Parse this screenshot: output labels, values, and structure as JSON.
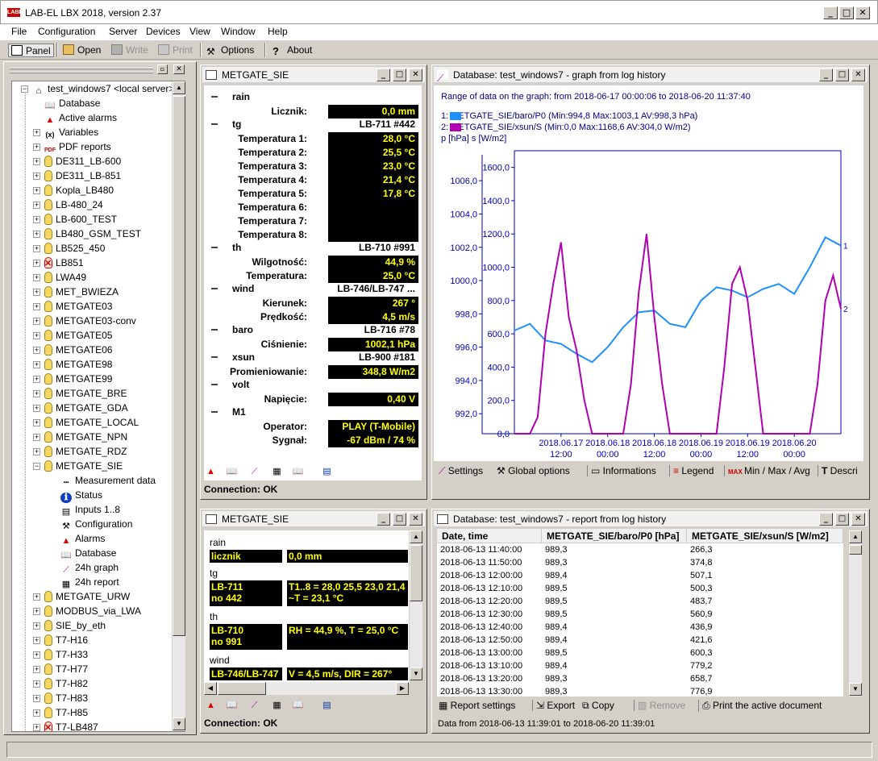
{
  "app": {
    "title": "LAB-EL LBX 2018, version 2.37",
    "logo": "LABEL"
  },
  "menu": [
    "File",
    "Configuration",
    "Server",
    "Devices",
    "View",
    "Window",
    "Help"
  ],
  "toolbar": {
    "panel": "Panel",
    "open": "Open",
    "write": "Write",
    "print": "Print",
    "options": "Options",
    "about": "About"
  },
  "tree": {
    "root": "test_windows7 <local server>",
    "items": [
      {
        "label": "Database",
        "icon": "book-icon",
        "exp": false
      },
      {
        "label": "Active alarms",
        "icon": "alarm-icon",
        "exp": false
      },
      {
        "label": "Variables",
        "icon": "variables-icon",
        "exp": true
      },
      {
        "label": "PDF reports",
        "icon": "pdf-icon",
        "exp": true
      },
      {
        "label": "DE311_LB-600",
        "icon": "bulb",
        "exp": true
      },
      {
        "label": "DE311_LB-851",
        "icon": "bulb",
        "exp": true
      },
      {
        "label": "Kopla_LB480",
        "icon": "bulb",
        "exp": true
      },
      {
        "label": "LB-480_24",
        "icon": "bulb",
        "exp": true
      },
      {
        "label": "LB-600_TEST",
        "icon": "bulb",
        "exp": true
      },
      {
        "label": "LB480_GSM_TEST",
        "icon": "bulb",
        "exp": true
      },
      {
        "label": "LB525_450",
        "icon": "bulb",
        "exp": true
      },
      {
        "label": "LB851",
        "icon": "bulb-red",
        "exp": true
      },
      {
        "label": "LWA49",
        "icon": "bulb",
        "exp": true
      },
      {
        "label": "MET_BWIEZA",
        "icon": "bulb",
        "exp": true
      },
      {
        "label": "METGATE03",
        "icon": "bulb",
        "exp": true
      },
      {
        "label": "METGATE03-conv",
        "icon": "bulb",
        "exp": true
      },
      {
        "label": "METGATE05",
        "icon": "bulb",
        "exp": true
      },
      {
        "label": "METGATE06",
        "icon": "bulb",
        "exp": true
      },
      {
        "label": "METGATE98",
        "icon": "bulb",
        "exp": true
      },
      {
        "label": "METGATE99",
        "icon": "bulb",
        "exp": true
      },
      {
        "label": "METGATE_BRE",
        "icon": "bulb",
        "exp": true
      },
      {
        "label": "METGATE_GDA",
        "icon": "bulb",
        "exp": true
      },
      {
        "label": "METGATE_LOCAL",
        "icon": "bulb",
        "exp": true
      },
      {
        "label": "METGATE_NPN",
        "icon": "bulb",
        "exp": true
      },
      {
        "label": "METGATE_RDZ",
        "icon": "bulb",
        "exp": true
      },
      {
        "label": "METGATE_SIE",
        "icon": "bulb",
        "exp": "open"
      },
      {
        "label": "Measurement data",
        "icon": "measurement-icon",
        "child": true
      },
      {
        "label": "Status",
        "icon": "info-icon",
        "child": true
      },
      {
        "label": "Inputs 1..8",
        "icon": "inputs-icon",
        "child": true
      },
      {
        "label": "Configuration",
        "icon": "config-icon",
        "child": true
      },
      {
        "label": "Alarms",
        "icon": "alarm-icon",
        "child": true
      },
      {
        "label": "Database",
        "icon": "book-icon",
        "child": true
      },
      {
        "label": "24h graph",
        "icon": "graph-icon",
        "child": true
      },
      {
        "label": "24h report",
        "icon": "grid-icon",
        "child": true
      },
      {
        "label": "METGATE_URW",
        "icon": "bulb",
        "exp": true
      },
      {
        "label": "MODBUS_via_LWA",
        "icon": "bulb",
        "exp": true
      },
      {
        "label": "SIE_by_eth",
        "icon": "bulb",
        "exp": true
      },
      {
        "label": "T7-H16",
        "icon": "bulb",
        "exp": true
      },
      {
        "label": "T7-H33",
        "icon": "bulb",
        "exp": true
      },
      {
        "label": "T7-H77",
        "icon": "bulb",
        "exp": true
      },
      {
        "label": "T7-H82",
        "icon": "bulb",
        "exp": true
      },
      {
        "label": "T7-H83",
        "icon": "bulb",
        "exp": true
      },
      {
        "label": "T7-H85",
        "icon": "bulb",
        "exp": true
      },
      {
        "label": "T7-LB487",
        "icon": "bulb-red",
        "exp": true
      }
    ]
  },
  "meas": {
    "title": "METGATE_SIE",
    "groups": [
      {
        "name": "rain",
        "device": "",
        "rows": [
          {
            "label": "Licznik:",
            "value": "0,0 mm"
          }
        ]
      },
      {
        "name": "tg",
        "device": "LB-711 #442",
        "rows": [
          {
            "label": "Temperatura 1:",
            "value": "28,0 °C"
          },
          {
            "label": "Temperatura 2:",
            "value": "25,5 °C"
          },
          {
            "label": "Temperatura 3:",
            "value": "23,0 °C"
          },
          {
            "label": "Temperatura 4:",
            "value": "21,4 °C"
          },
          {
            "label": "Temperatura 5:",
            "value": "17,8 °C"
          },
          {
            "label": "Temperatura 6:",
            "value": ""
          },
          {
            "label": "Temperatura 7:",
            "value": ""
          },
          {
            "label": "Temperatura 8:",
            "value": ""
          }
        ]
      },
      {
        "name": "th",
        "device": "LB-710 #991",
        "rows": [
          {
            "label": "Wilgotność:",
            "value": "44,9 %"
          },
          {
            "label": "Temperatura:",
            "value": "25,0 °C"
          }
        ]
      },
      {
        "name": "wind",
        "device": "LB-746/LB-747 ...",
        "rows": [
          {
            "label": "Kierunek:",
            "value": "267 °"
          },
          {
            "label": "Prędkość:",
            "value": "4,5 m/s"
          }
        ]
      },
      {
        "name": "baro",
        "device": "LB-716 #78",
        "rows": [
          {
            "label": "Ciśnienie:",
            "value": "1002,1 hPa"
          }
        ]
      },
      {
        "name": "xsun",
        "device": "LB-900 #181",
        "rows": [
          {
            "label": "Promieniowanie:",
            "value": "348,8 W/m2"
          }
        ]
      },
      {
        "name": "volt",
        "device": "",
        "rows": [
          {
            "label": "Napięcie:",
            "value": "0,40 V"
          }
        ]
      },
      {
        "name": "M1",
        "device": "",
        "rows": [
          {
            "label": "Operator:",
            "value": "PLAY (T-Mobile)"
          },
          {
            "label": "Sygnał:",
            "value": "-67 dBm / 74 %"
          }
        ]
      }
    ],
    "connection": "Connection: OK"
  },
  "sensors": {
    "title": "METGATE_SIE",
    "groups": [
      {
        "name": "rain",
        "dev": "licznik",
        "val": "0,0 mm"
      },
      {
        "name": "tg",
        "dev": "LB-711\nno 442",
        "val": "T1..8 = 28,0 25,5 23,0 21,4\n~T = 23,1 °C"
      },
      {
        "name": "th",
        "dev": "LB-710\nno 991",
        "val": "RH = 44,9 %, T = 25,0 °C"
      },
      {
        "name": "wind",
        "dev": "LB-746/LB-747",
        "val": "V = 4,5 m/s, DIR = 267°"
      }
    ],
    "connection": "Connection: OK"
  },
  "graph": {
    "title": "Database: test_windows7 - graph from log history",
    "range": "Range of data on the graph:  from 2018-06-17 00:00:06 to 2018-06-20 11:37:40",
    "legend1": "1:     METGATE_SIE/baro/P0 (Min:994,8 Max:1003,1 AV:998,3 hPa)",
    "legend2": "2:     METGATE_SIE/xsun/S (Min:0,0 Max:1168,6 AV:304,0 W/m2)",
    "units": "p [hPa]   s [W/m2]",
    "tabs": [
      "Settings",
      "Global options",
      "Informations",
      "Legend",
      "Min / Max / Avg",
      "Descri"
    ],
    "colors": {
      "series1": "#1e90ff",
      "series2": "#b000b0",
      "axis": "#0000c0"
    }
  },
  "chart_data": {
    "type": "line",
    "x_ticks": [
      "2018.06.17\n12:00",
      "2018.06.18\n00:00",
      "2018.06.18\n12:00",
      "2018.06.19\n00:00",
      "2018.06.19\n12:00",
      "2018.06.20\n00:00"
    ],
    "y_left": {
      "label": "p [hPa]",
      "ticks": [
        "992,0",
        "994,0",
        "996,0",
        "998,0",
        "1000,0",
        "1002,0",
        "1004,0",
        "1006,0"
      ],
      "lim": [
        990.8,
        1007.8
      ]
    },
    "y_right": {
      "label": "s [W/m2]",
      "ticks": [
        "0,0",
        "200,0",
        "400,0",
        "600,0",
        "800,0",
        "1000,0",
        "1200,0",
        "1400,0",
        "1600,0"
      ],
      "lim": [
        0,
        1700
      ]
    },
    "series": [
      {
        "name": "METGATE_SIE/baro/P0",
        "axis": "left",
        "marker": "1",
        "x": [
          0,
          4,
          8,
          12,
          16,
          20,
          24,
          28,
          32,
          36,
          40,
          44,
          48,
          52,
          56,
          60,
          64,
          68,
          72,
          76,
          80,
          84
        ],
        "y": [
          997.0,
          997.4,
          996.4,
          996.2,
          995.6,
          995.1,
          996.0,
          997.2,
          998.1,
          998.2,
          997.4,
          997.2,
          998.8,
          999.6,
          999.4,
          999.0,
          999.5,
          999.8,
          999.2,
          1000.8,
          1002.6,
          1002.1
        ]
      },
      {
        "name": "METGATE_SIE/xsun/S",
        "axis": "right",
        "marker": "2",
        "x": [
          0,
          4,
          6,
          8,
          10,
          12,
          14,
          16,
          18,
          20,
          24,
          28,
          30,
          32,
          34,
          36,
          38,
          40,
          44,
          48,
          52,
          54,
          56,
          58,
          60,
          62,
          64,
          68,
          72,
          76,
          78,
          80,
          82,
          84
        ],
        "y": [
          0,
          0,
          100,
          600,
          900,
          1150,
          700,
          500,
          200,
          0,
          0,
          0,
          300,
          850,
          1200,
          700,
          300,
          0,
          0,
          0,
          0,
          400,
          900,
          1000,
          800,
          400,
          0,
          0,
          0,
          0,
          300,
          800,
          950,
          750
        ]
      }
    ]
  },
  "report": {
    "title": "Database: test_windows7 - report from log history",
    "headers": [
      "Date, time",
      "METGATE_SIE/baro/P0 [hPa]",
      "METGATE_SIE/xsun/S [W/m2]"
    ],
    "rows": [
      [
        "2018-06-13 11:40:00",
        "989,3",
        "266,3"
      ],
      [
        "2018-06-13 11:50:00",
        "989,3",
        "374,8"
      ],
      [
        "2018-06-13 12:00:00",
        "989,4",
        "507,1"
      ],
      [
        "2018-06-13 12:10:00",
        "989,5",
        "500,3"
      ],
      [
        "2018-06-13 12:20:00",
        "989,5",
        "483,7"
      ],
      [
        "2018-06-13 12:30:00",
        "989,5",
        "560,9"
      ],
      [
        "2018-06-13 12:40:00",
        "989,4",
        "436,9"
      ],
      [
        "2018-06-13 12:50:00",
        "989,4",
        "421,6"
      ],
      [
        "2018-06-13 13:00:00",
        "989,5",
        "600,3"
      ],
      [
        "2018-06-13 13:10:00",
        "989,4",
        "779,2"
      ],
      [
        "2018-06-13 13:20:00",
        "989,3",
        "658,7"
      ],
      [
        "2018-06-13 13:30:00",
        "989,3",
        "776,9"
      ]
    ],
    "buttons": [
      "Report settings",
      "Export",
      "Copy",
      "Remove",
      "Print the active document"
    ],
    "footer": "Data from 2018-06-13 11:39:01 to 2018-06-20 11:39:01"
  }
}
